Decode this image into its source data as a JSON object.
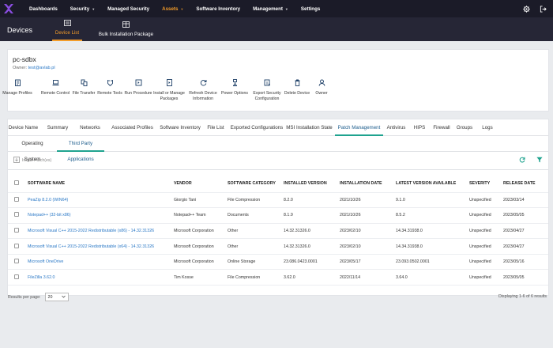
{
  "nav": {
    "items": [
      {
        "label": "Dashboards",
        "chevron": false,
        "active": false
      },
      {
        "label": "Security",
        "chevron": true,
        "active": false
      },
      {
        "label": "Managed Security",
        "chevron": false,
        "active": false
      },
      {
        "label": "Assets",
        "chevron": true,
        "active": true
      },
      {
        "label": "Software Inventory",
        "chevron": false,
        "active": false
      },
      {
        "label": "Management",
        "chevron": true,
        "active": false
      },
      {
        "label": "Settings",
        "chevron": false,
        "active": false
      }
    ],
    "icons": [
      "logo-icon",
      "gear-icon",
      "logout-icon"
    ],
    "accent": "#f39c2a"
  },
  "subheader": {
    "title": "Devices",
    "tabs": [
      {
        "label": "Device List",
        "icon": "device-list-icon",
        "active": true
      },
      {
        "label": "Bulk Installation Package",
        "icon": "package-icon",
        "active": false
      }
    ]
  },
  "device": {
    "name": "pc-sdbx",
    "owner_label": "Owner:",
    "owner_email": "test@avlab.pl",
    "actions": [
      {
        "label1": "Manage Profiles",
        "label2": "",
        "icon": "profiles-icon"
      },
      {
        "label1": "Remote Control",
        "label2": "",
        "icon": "laptop-icon"
      },
      {
        "label1": "File Transfer",
        "label2": "",
        "icon": "file-transfer-icon"
      },
      {
        "label1": "Remote Tools",
        "label2": "",
        "icon": "remote-tools-icon"
      },
      {
        "label1": "Run Procedure",
        "label2": "",
        "icon": "run-procedure-icon"
      },
      {
        "label1": "Install or Manage",
        "label2": "Packages",
        "icon": "install-package-icon"
      },
      {
        "label1": "Refresh Device",
        "label2": "Information",
        "icon": "refresh-icon"
      },
      {
        "label1": "Power Options",
        "label2": "",
        "icon": "power-icon"
      },
      {
        "label1": "Export Security",
        "label2": "Configuration",
        "icon": "export-icon"
      },
      {
        "label1": "Delete Device",
        "label2": "",
        "icon": "delete-icon"
      },
      {
        "label1": "Owner",
        "label2": "",
        "icon": "owner-icon"
      }
    ]
  },
  "tabs": {
    "primary": [
      {
        "label": "Device Name",
        "active": false
      },
      {
        "label": "Summary",
        "active": false
      },
      {
        "label": "Networks",
        "active": false
      },
      {
        "label": "Associated Profiles",
        "active": false
      },
      {
        "label": "Software Inventory",
        "active": false
      },
      {
        "label": "File List",
        "active": false
      },
      {
        "label": "Exported Configurations",
        "active": false
      },
      {
        "label": "MSI Installation State",
        "active": false
      },
      {
        "label": "Patch Management",
        "active": true
      },
      {
        "label": "Antivirus",
        "active": false
      },
      {
        "label": "HIPS",
        "active": false
      },
      {
        "label": "Firewall",
        "active": false
      },
      {
        "label": "Groups",
        "active": false
      },
      {
        "label": "Logs",
        "active": false
      }
    ],
    "secondary": [
      {
        "label": "Operating System",
        "active": false
      },
      {
        "label": "Third Party Applications",
        "active": true
      }
    ]
  },
  "toolbar": {
    "install_label": "Install Patch(es)",
    "icons": [
      "refresh-icon",
      "filter-icon"
    ]
  },
  "table": {
    "headers": [
      "SOFTWARE NAME",
      "VENDOR",
      "SOFTWARE CATEGORY",
      "INSTALLED VERSION",
      "INSTALLATION DATE",
      "LATEST VERSION AVAILABLE",
      "SEVERITY",
      "RELEASE DATE"
    ],
    "rows": [
      [
        "PeaZip 8.2.0 (WIN64)",
        "Giorgio Tani",
        "File Compression",
        "8.2.0",
        "2021/10/26",
        "9.1.0",
        "Unspecified",
        "2023/03/14"
      ],
      [
        "Notepad++ (32-bit x86)",
        "Notepad++ Team",
        "Documents",
        "8.1.9",
        "2021/10/26",
        "8.5.2",
        "Unspecified",
        "2023/05/05"
      ],
      [
        "Microsoft Visual C++ 2015-2022 Redistributable (x86) - 14.32.31326",
        "Microsoft Corporation",
        "Other",
        "14.32.31326.0",
        "2023/02/10",
        "14.34.31938.0",
        "Unspecified",
        "2023/04/27"
      ],
      [
        "Microsoft Visual C++ 2015-2022 Redistributable (x64) - 14.32.31326",
        "Microsoft Corporation",
        "Other",
        "14.32.31326.0",
        "2023/02/10",
        "14.34.31938.0",
        "Unspecified",
        "2023/04/27"
      ],
      [
        "Microsoft OneDrive",
        "Microsoft Corporation",
        "Online Storage",
        "23.086.0423.0001",
        "2023/05/17",
        "23.093.0502.0001",
        "Unspecified",
        "2023/05/16"
      ],
      [
        "FileZilla 3.62.0",
        "Tim Kosse",
        "File Compression",
        "3.62.0",
        "2022/11/14",
        "3.64.0",
        "Unspecified",
        "2023/05/05"
      ]
    ]
  },
  "footer": {
    "rpp_label": "Results per page:",
    "rpp_value": "20",
    "displaying": "Displaying 1-6 of 6 results"
  },
  "colors": {
    "link": "#2a78c6",
    "tab_underline": "#1fa38f",
    "nav_bg": "#1b1b28"
  }
}
